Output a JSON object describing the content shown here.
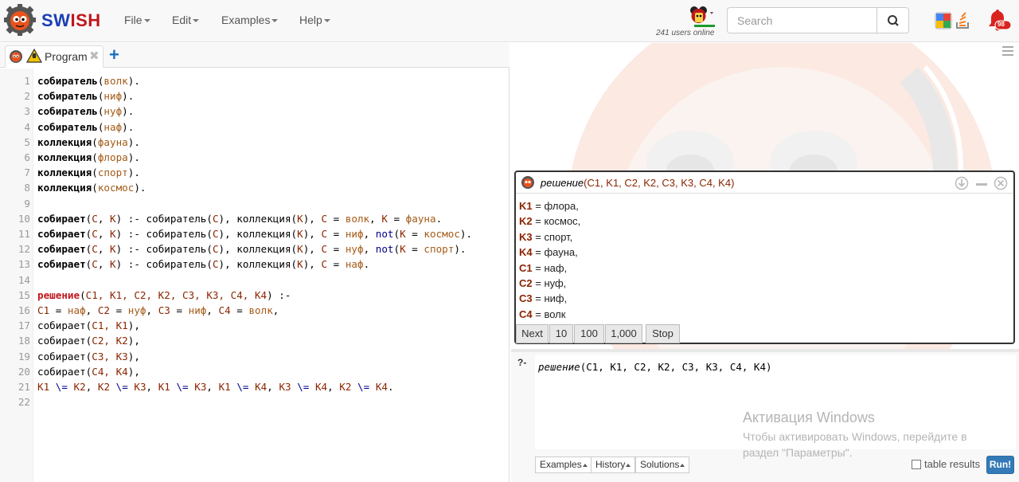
{
  "app": {
    "brand_sw": "SW",
    "brand_ish": "ISH",
    "menu": [
      {
        "label": "File"
      },
      {
        "label": "Edit"
      },
      {
        "label": "Examples"
      },
      {
        "label": "Help"
      }
    ],
    "users_online": "241 users online",
    "search_placeholder": "Search",
    "notification_count": "98"
  },
  "editor": {
    "tab_label": "Program",
    "lines": [
      {
        "n": "1"
      },
      {
        "n": "2"
      },
      {
        "n": "3"
      },
      {
        "n": "4"
      },
      {
        "n": "5"
      },
      {
        "n": "6"
      },
      {
        "n": "7"
      },
      {
        "n": "8"
      },
      {
        "n": "9"
      },
      {
        "n": "10"
      },
      {
        "n": "11"
      },
      {
        "n": "12"
      },
      {
        "n": "13"
      },
      {
        "n": "14"
      },
      {
        "n": "15"
      },
      {
        "n": "16"
      },
      {
        "n": "17"
      },
      {
        "n": "18"
      },
      {
        "n": "19"
      },
      {
        "n": "20"
      },
      {
        "n": "21"
      },
      {
        "n": "22"
      }
    ],
    "code": {
      "l1": [
        "собиратель",
        "(",
        "волк",
        ")."
      ],
      "l2": [
        "собиратель",
        "(",
        "ниф",
        ")."
      ],
      "l3": [
        "собиратель",
        "(",
        "нуф",
        ")."
      ],
      "l4": [
        "собиратель",
        "(",
        "наф",
        ")."
      ],
      "l5": [
        "коллекция",
        "(",
        "фауна",
        ")."
      ],
      "l6": [
        "коллекция",
        "(",
        "флора",
        ")."
      ],
      "l7": [
        "коллекция",
        "(",
        "спорт",
        ")."
      ],
      "l8": [
        "коллекция",
        "(",
        "космос",
        ")."
      ],
      "l10": [
        "собирает",
        "(",
        "C",
        ", ",
        "K",
        ") :- собиратель(",
        "C",
        "), коллекция(",
        "K",
        "), ",
        "C",
        " = ",
        "волк",
        ", ",
        "K",
        " = ",
        "фауна",
        "."
      ],
      "l11": [
        "собирает",
        "(",
        "C",
        ", ",
        "K",
        ") :- собиратель(",
        "C",
        "), коллекция(",
        "K",
        "), ",
        "C",
        " = ",
        "ниф",
        ", ",
        "not",
        "(",
        "K",
        " = ",
        "космос",
        ")."
      ],
      "l12": [
        "собирает",
        "(",
        "C",
        ", ",
        "K",
        ") :- собиратель(",
        "C",
        "), коллекция(",
        "K",
        "), ",
        "C",
        " = ",
        "нуф",
        ", ",
        "not",
        "(",
        "K",
        " = ",
        "спорт",
        ")."
      ],
      "l13": [
        "собирает",
        "(",
        "C",
        ", ",
        "K",
        ") :- собиратель(",
        "C",
        "), коллекция(",
        "K",
        "), ",
        "C",
        " = ",
        "наф",
        "."
      ],
      "l15": [
        "решение",
        "(",
        "C1, K1, C2, K2, C3, K3, C4, K4",
        ") :-"
      ],
      "l16": [
        "C1",
        " = ",
        "наф",
        ", ",
        "C2",
        " = ",
        "нуф",
        ", ",
        "C3",
        " = ",
        "ниф",
        ", ",
        "C4",
        " = ",
        "волк",
        ","
      ],
      "l17": [
        "собирает(",
        "C1, K1",
        "),"
      ],
      "l18": [
        "собирает(",
        "C2, K2",
        "),"
      ],
      "l19": [
        "собирает(",
        "C3, K3",
        "),"
      ],
      "l20": [
        "собирает(",
        "C4, K4",
        "),"
      ],
      "l21": [
        "K1",
        " \\= ",
        "K2",
        ", ",
        "K2",
        " \\= ",
        "K3",
        ", ",
        "K1",
        " \\= ",
        "K3",
        ", ",
        "K1",
        " \\= ",
        "K4",
        ", ",
        "K3",
        " \\= ",
        "K4",
        ", ",
        "K2",
        " \\= ",
        "K4",
        "."
      ]
    }
  },
  "answer": {
    "goal": "решение",
    "args": "(C1, K1, C2, K2, C3, K3, C4, K4)",
    "bindings": [
      {
        "var": "K1",
        "value": " = флора,"
      },
      {
        "var": "K2",
        "value": " = космос,"
      },
      {
        "var": "K3",
        "value": " = спорт,"
      },
      {
        "var": "K4",
        "value": " = фауна,"
      },
      {
        "var": "C1",
        "value": " = наф,"
      },
      {
        "var": "C2",
        "value": " = нуф,"
      },
      {
        "var": "C3",
        "value": " = ниф,"
      },
      {
        "var": "C4",
        "value": " = волк"
      }
    ],
    "buttons": {
      "next": "Next",
      "ten": "10",
      "hundred": "100",
      "thousand": "1,000",
      "stop": "Stop"
    }
  },
  "query": {
    "prompt": "?-",
    "goal": "решение",
    "args": "(C1, K1, C2, K2, C3, K3, C4, K4)",
    "examples": "Examples",
    "history": "History",
    "solutions": "Solutions",
    "table_results": "table results",
    "run": "Run!"
  },
  "watermark": {
    "title": "Активация Windows",
    "line1": "Чтобы активировать Windows, перейдите в",
    "line2": "раздел \"Параметры\"."
  },
  "colors": {
    "brand_blue": "#1a3fb5",
    "brand_red": "#c0161c",
    "run_blue": "#337ab7",
    "var_color": "#8b2500"
  }
}
